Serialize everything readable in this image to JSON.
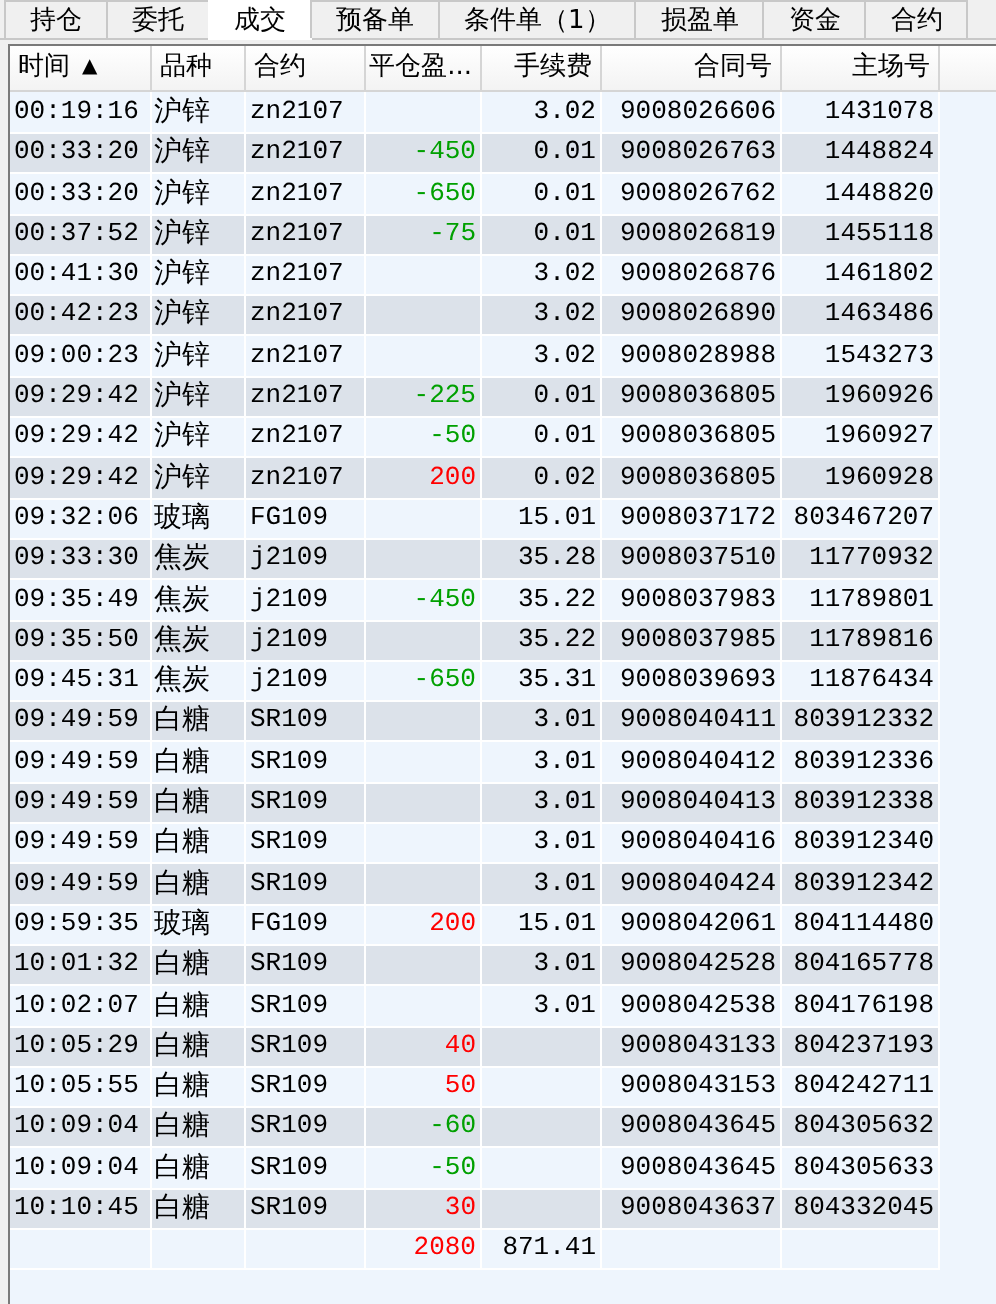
{
  "tabs": [
    {
      "label": "持仓",
      "selected": false
    },
    {
      "label": "委托",
      "selected": false
    },
    {
      "label": "成交",
      "selected": true
    },
    {
      "label": "预备单",
      "selected": false
    },
    {
      "label": "条件单（1）",
      "selected": false
    },
    {
      "label": "损盈单",
      "selected": false
    },
    {
      "label": "资金",
      "selected": false
    },
    {
      "label": "合约",
      "selected": false
    }
  ],
  "table": {
    "columns": [
      {
        "label": "时间",
        "sort_mark": "▲"
      },
      {
        "label": "品种"
      },
      {
        "label": "合约"
      },
      {
        "label": "平仓盈..."
      },
      {
        "label": "手续费"
      },
      {
        "label": "合同号"
      },
      {
        "label": "主场号"
      }
    ],
    "rows": [
      {
        "time": "00:19:16",
        "product": "沪锌",
        "contract": "zn2107",
        "fee": "3.02",
        "order_no": "9008026606",
        "exchange_no": "1431078"
      },
      {
        "time": "00:33:20",
        "product": "沪锌",
        "contract": "zn2107",
        "pnl": {
          "text": "-450",
          "kind": "loss"
        },
        "fee": "0.01",
        "order_no": "9008026763",
        "exchange_no": "1448824"
      },
      {
        "time": "00:33:20",
        "product": "沪锌",
        "contract": "zn2107",
        "pnl": {
          "text": "-650",
          "kind": "loss"
        },
        "fee": "0.01",
        "order_no": "9008026762",
        "exchange_no": "1448820"
      },
      {
        "time": "00:37:52",
        "product": "沪锌",
        "contract": "zn2107",
        "pnl": {
          "text": "-75",
          "kind": "loss"
        },
        "fee": "0.01",
        "order_no": "9008026819",
        "exchange_no": "1455118"
      },
      {
        "time": "00:41:30",
        "product": "沪锌",
        "contract": "zn2107",
        "fee": "3.02",
        "order_no": "9008026876",
        "exchange_no": "1461802"
      },
      {
        "time": "00:42:23",
        "product": "沪锌",
        "contract": "zn2107",
        "fee": "3.02",
        "order_no": "9008026890",
        "exchange_no": "1463486"
      },
      {
        "time": "09:00:23",
        "product": "沪锌",
        "contract": "zn2107",
        "fee": "3.02",
        "order_no": "9008028988",
        "exchange_no": "1543273"
      },
      {
        "time": "09:29:42",
        "product": "沪锌",
        "contract": "zn2107",
        "pnl": {
          "text": "-225",
          "kind": "loss"
        },
        "fee": "0.01",
        "order_no": "9008036805",
        "exchange_no": "1960926"
      },
      {
        "time": "09:29:42",
        "product": "沪锌",
        "contract": "zn2107",
        "pnl": {
          "text": "-50",
          "kind": "loss"
        },
        "fee": "0.01",
        "order_no": "9008036805",
        "exchange_no": "1960927"
      },
      {
        "time": "09:29:42",
        "product": "沪锌",
        "contract": "zn2107",
        "pnl": {
          "text": "200",
          "kind": "profit"
        },
        "fee": "0.02",
        "order_no": "9008036805",
        "exchange_no": "1960928"
      },
      {
        "time": "09:32:06",
        "product": "玻璃",
        "contract": "FG109",
        "fee": "15.01",
        "order_no": "9008037172",
        "exchange_no": "803467207"
      },
      {
        "time": "09:33:30",
        "product": "焦炭",
        "contract": "j2109",
        "fee": "35.28",
        "order_no": "9008037510",
        "exchange_no": "11770932"
      },
      {
        "time": "09:35:49",
        "product": "焦炭",
        "contract": "j2109",
        "pnl": {
          "text": "-450",
          "kind": "loss"
        },
        "fee": "35.22",
        "order_no": "9008037983",
        "exchange_no": "11789801"
      },
      {
        "time": "09:35:50",
        "product": "焦炭",
        "contract": "j2109",
        "fee": "35.22",
        "order_no": "9008037985",
        "exchange_no": "11789816"
      },
      {
        "time": "09:45:31",
        "product": "焦炭",
        "contract": "j2109",
        "pnl": {
          "text": "-650",
          "kind": "loss"
        },
        "fee": "35.31",
        "order_no": "9008039693",
        "exchange_no": "11876434"
      },
      {
        "time": "09:49:59",
        "product": "白糖",
        "contract": "SR109",
        "fee": "3.01",
        "order_no": "9008040411",
        "exchange_no": "803912332"
      },
      {
        "time": "09:49:59",
        "product": "白糖",
        "contract": "SR109",
        "fee": "3.01",
        "order_no": "9008040412",
        "exchange_no": "803912336"
      },
      {
        "time": "09:49:59",
        "product": "白糖",
        "contract": "SR109",
        "fee": "3.01",
        "order_no": "9008040413",
        "exchange_no": "803912338"
      },
      {
        "time": "09:49:59",
        "product": "白糖",
        "contract": "SR109",
        "fee": "3.01",
        "order_no": "9008040416",
        "exchange_no": "803912340"
      },
      {
        "time": "09:49:59",
        "product": "白糖",
        "contract": "SR109",
        "fee": "3.01",
        "order_no": "9008040424",
        "exchange_no": "803912342"
      },
      {
        "time": "09:59:35",
        "product": "玻璃",
        "contract": "FG109",
        "pnl": {
          "text": "200",
          "kind": "profit"
        },
        "fee": "15.01",
        "order_no": "9008042061",
        "exchange_no": "804114480"
      },
      {
        "time": "10:01:32",
        "product": "白糖",
        "contract": "SR109",
        "fee": "3.01",
        "order_no": "9008042528",
        "exchange_no": "804165778"
      },
      {
        "time": "10:02:07",
        "product": "白糖",
        "contract": "SR109",
        "fee": "3.01",
        "order_no": "9008042538",
        "exchange_no": "804176198"
      },
      {
        "time": "10:05:29",
        "product": "白糖",
        "contract": "SR109",
        "pnl": {
          "text": "40",
          "kind": "profit"
        },
        "order_no": "9008043133",
        "exchange_no": "804237193"
      },
      {
        "time": "10:05:55",
        "product": "白糖",
        "contract": "SR109",
        "pnl": {
          "text": "50",
          "kind": "profit"
        },
        "order_no": "9008043153",
        "exchange_no": "804242711"
      },
      {
        "time": "10:09:04",
        "product": "白糖",
        "contract": "SR109",
        "pnl": {
          "text": "-60",
          "kind": "loss"
        },
        "order_no": "9008043645",
        "exchange_no": "804305632"
      },
      {
        "time": "10:09:04",
        "product": "白糖",
        "contract": "SR109",
        "pnl": {
          "text": "-50",
          "kind": "loss"
        },
        "order_no": "9008043645",
        "exchange_no": "804305633"
      },
      {
        "time": "10:10:45",
        "product": "白糖",
        "contract": "SR109",
        "pnl": {
          "text": "30",
          "kind": "profit"
        },
        "order_no": "9008043637",
        "exchange_no": "804332045"
      }
    ],
    "total": {
      "pnl": {
        "text": "2080",
        "kind": "profit"
      },
      "fee": "871.41"
    }
  }
}
